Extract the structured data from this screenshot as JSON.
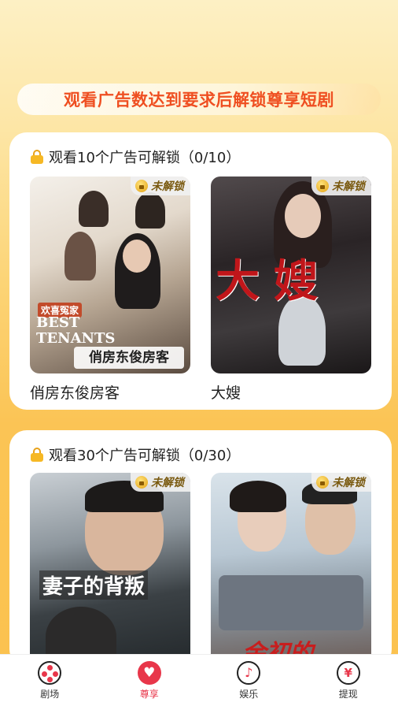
{
  "banner": {
    "text": "观看广告数达到要求后解锁尊享短剧"
  },
  "sections": [
    {
      "title": "观看10个广告可解锁（0/10）",
      "items": [
        {
          "badge": "未解锁",
          "poster_caption": "俏房东俊房客",
          "poster_text": "BEST TENANTS",
          "poster_tag": "欢喜冤家",
          "title": "俏房东俊房客"
        },
        {
          "badge": "未解锁",
          "poster_caption": "大嫂",
          "title": "大嫂"
        }
      ]
    },
    {
      "title": "观看30个广告可解锁（0/30）",
      "items": [
        {
          "badge": "未解锁",
          "poster_caption": "妻子的背叛",
          "title": ""
        },
        {
          "badge": "未解锁",
          "poster_caption": "余初的",
          "title": ""
        }
      ]
    }
  ],
  "tabbar": [
    {
      "label": "剧场",
      "icon": "theater-icon",
      "active": false
    },
    {
      "label": "尊享",
      "icon": "heart-icon",
      "active": true
    },
    {
      "label": "娱乐",
      "icon": "music-icon",
      "active": false
    },
    {
      "label": "提现",
      "icon": "yen-icon",
      "active": false
    }
  ],
  "colors": {
    "accent": "#e8364a",
    "banner_text": "#ef4f21",
    "background": "#fbc24e"
  }
}
